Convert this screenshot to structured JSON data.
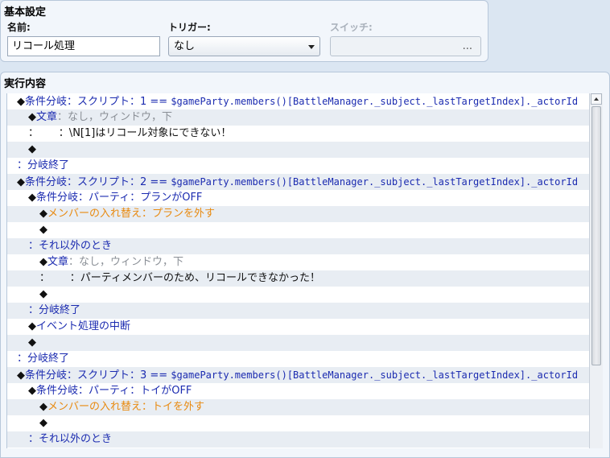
{
  "basic": {
    "title": "基本設定",
    "name_label": "名前:",
    "name_value": "リコール処理",
    "trigger_label": "トリガー:",
    "trigger_value": "なし",
    "switch_label": "スイッチ:",
    "switch_button": "..."
  },
  "execution": {
    "title": "実行内容",
    "rows": [
      {
        "indent": 0,
        "parts": [
          {
            "t": "◆",
            "c": "black"
          },
          {
            "t": "条件分岐：スクリプト：1 == ",
            "c": "blue"
          },
          {
            "t": "$gameParty.members()[BattleManager._subject._lastTargetIndex]._actorId",
            "c": "blue",
            "mono": true
          }
        ]
      },
      {
        "indent": 1,
        "parts": [
          {
            "t": "◆",
            "c": "black"
          },
          {
            "t": "文章",
            "c": "blue"
          },
          {
            "t": "：なし，ウィンドウ，下",
            "c": "gray"
          }
        ]
      },
      {
        "indent": 1,
        "parts": [
          {
            "t": "：",
            "c": "text"
          },
          {
            "t": "      ：\\N[1]はリコール対象にできない！",
            "c": "text"
          }
        ]
      },
      {
        "indent": 1,
        "parts": [
          {
            "t": "◆",
            "c": "black"
          }
        ]
      },
      {
        "indent": 0,
        "parts": [
          {
            "t": "：分岐終了",
            "c": "blue"
          }
        ]
      },
      {
        "indent": 0,
        "parts": [
          {
            "t": "◆",
            "c": "black"
          },
          {
            "t": "条件分岐：スクリプト：2 == ",
            "c": "blue"
          },
          {
            "t": "$gameParty.members()[BattleManager._subject._lastTargetIndex]._actorId",
            "c": "blue",
            "mono": true
          }
        ]
      },
      {
        "indent": 1,
        "parts": [
          {
            "t": "◆",
            "c": "black"
          },
          {
            "t": "条件分岐：パーティ：プランがOFF",
            "c": "blue"
          }
        ]
      },
      {
        "indent": 2,
        "parts": [
          {
            "t": "◆",
            "c": "black"
          },
          {
            "t": "メンバーの入れ替え：プランを外す",
            "c": "orange"
          }
        ]
      },
      {
        "indent": 2,
        "parts": [
          {
            "t": "◆",
            "c": "black"
          }
        ]
      },
      {
        "indent": 1,
        "parts": [
          {
            "t": "：それ以外のとき",
            "c": "blue"
          }
        ]
      },
      {
        "indent": 2,
        "parts": [
          {
            "t": "◆",
            "c": "black"
          },
          {
            "t": "文章",
            "c": "blue"
          },
          {
            "t": "：なし，ウィンドウ，下",
            "c": "gray"
          }
        ]
      },
      {
        "indent": 2,
        "parts": [
          {
            "t": "：",
            "c": "text"
          },
          {
            "t": "      ：パーティメンバーのため、リコールできなかった！",
            "c": "text"
          }
        ]
      },
      {
        "indent": 2,
        "parts": [
          {
            "t": "◆",
            "c": "black"
          }
        ]
      },
      {
        "indent": 1,
        "parts": [
          {
            "t": "：分岐終了",
            "c": "blue"
          }
        ]
      },
      {
        "indent": 1,
        "parts": [
          {
            "t": "◆",
            "c": "black"
          },
          {
            "t": "イベント処理の中断",
            "c": "blue"
          }
        ]
      },
      {
        "indent": 1,
        "parts": [
          {
            "t": "◆",
            "c": "black"
          }
        ]
      },
      {
        "indent": 0,
        "parts": [
          {
            "t": "：分岐終了",
            "c": "blue"
          }
        ]
      },
      {
        "indent": 0,
        "parts": [
          {
            "t": "◆",
            "c": "black"
          },
          {
            "t": "条件分岐：スクリプト：3 == ",
            "c": "blue"
          },
          {
            "t": "$gameParty.members()[BattleManager._subject._lastTargetIndex]._actorId",
            "c": "blue",
            "mono": true
          }
        ]
      },
      {
        "indent": 1,
        "parts": [
          {
            "t": "◆",
            "c": "black"
          },
          {
            "t": "条件分岐：パーティ：トイがOFF",
            "c": "blue"
          }
        ]
      },
      {
        "indent": 2,
        "parts": [
          {
            "t": "◆",
            "c": "black"
          },
          {
            "t": "メンバーの入れ替え：トイを外す",
            "c": "orange"
          }
        ]
      },
      {
        "indent": 2,
        "parts": [
          {
            "t": "◆",
            "c": "black"
          }
        ]
      },
      {
        "indent": 1,
        "parts": [
          {
            "t": "：それ以外のとき",
            "c": "blue"
          }
        ]
      }
    ]
  }
}
